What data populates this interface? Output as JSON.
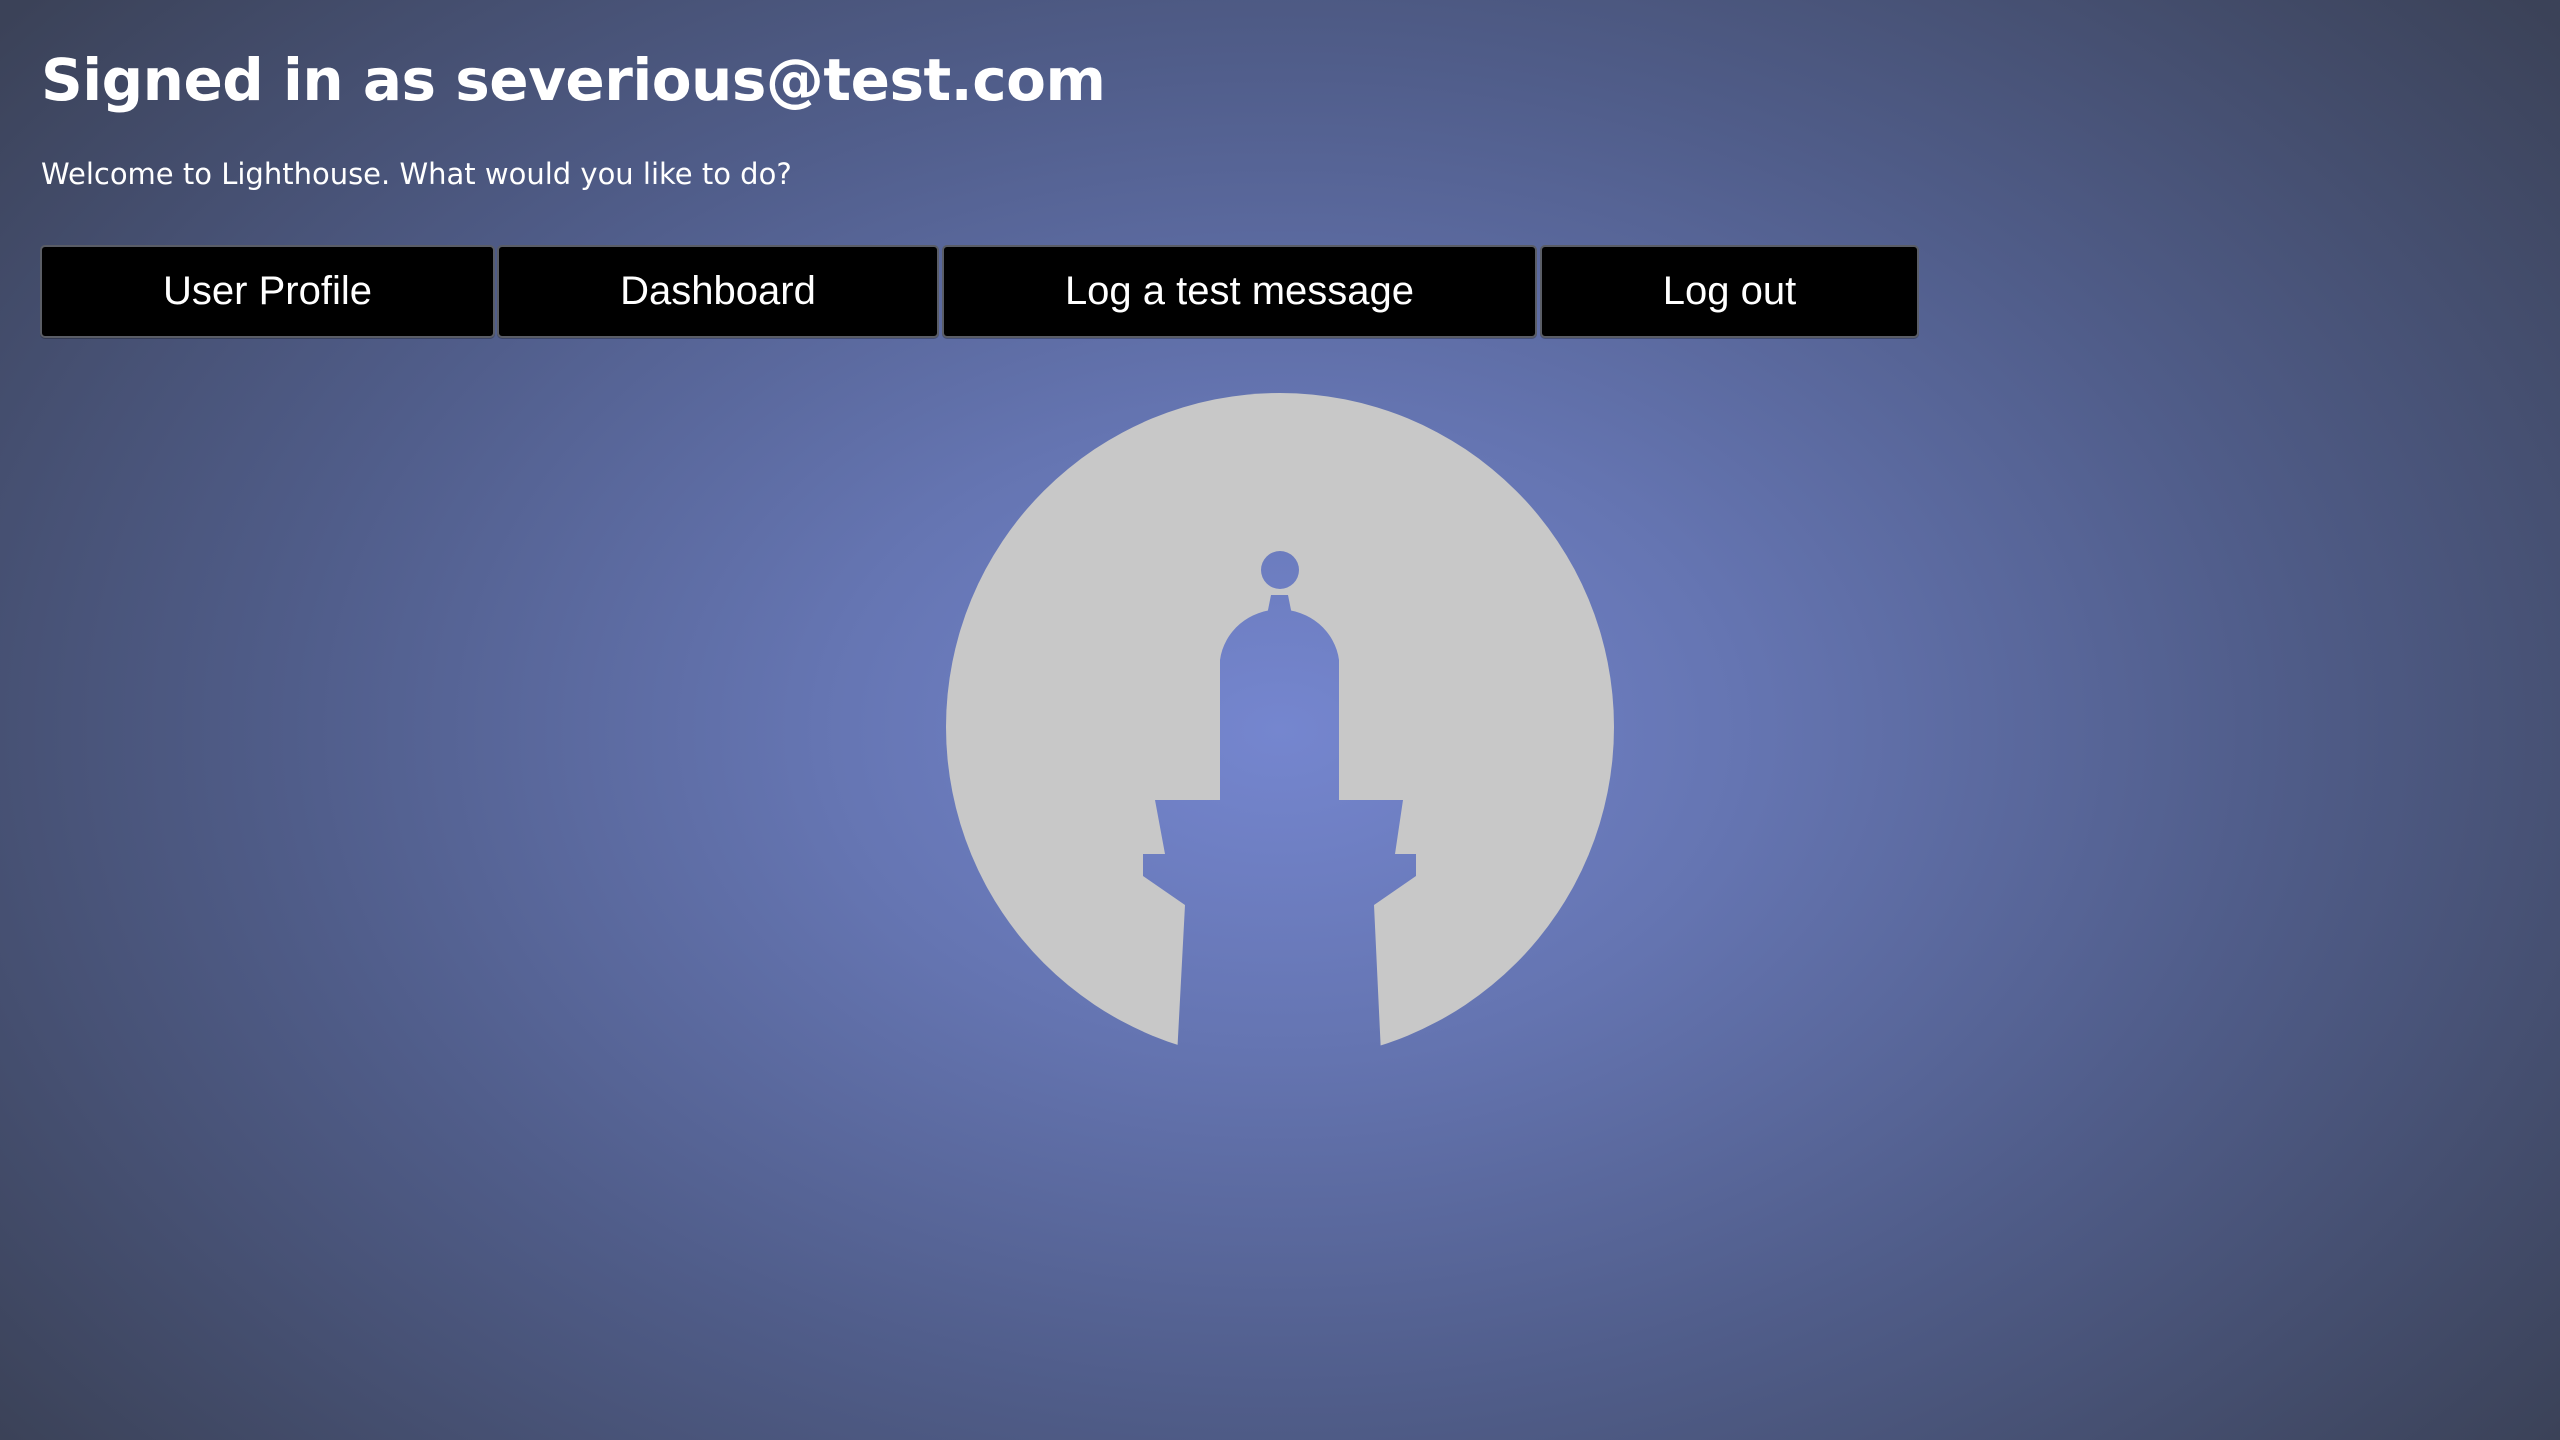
{
  "header": {
    "title": "Signed in as severious@test.com",
    "welcome": "Welcome to Lighthouse. What would you like to do?"
  },
  "actions": [
    {
      "id": "user-profile",
      "label": "User Profile"
    },
    {
      "id": "dashboard",
      "label": "Dashboard"
    },
    {
      "id": "log-test-message",
      "label": "Log a test message"
    },
    {
      "id": "log-out",
      "label": "Log out"
    }
  ],
  "logo": {
    "icon": "lighthouse-logo-icon",
    "circle_color": "#c8c8c8"
  },
  "colors": {
    "background_center": "#7586cf",
    "background_edge": "#3b4258",
    "button_background": "#000000",
    "text": "#ffffff"
  }
}
